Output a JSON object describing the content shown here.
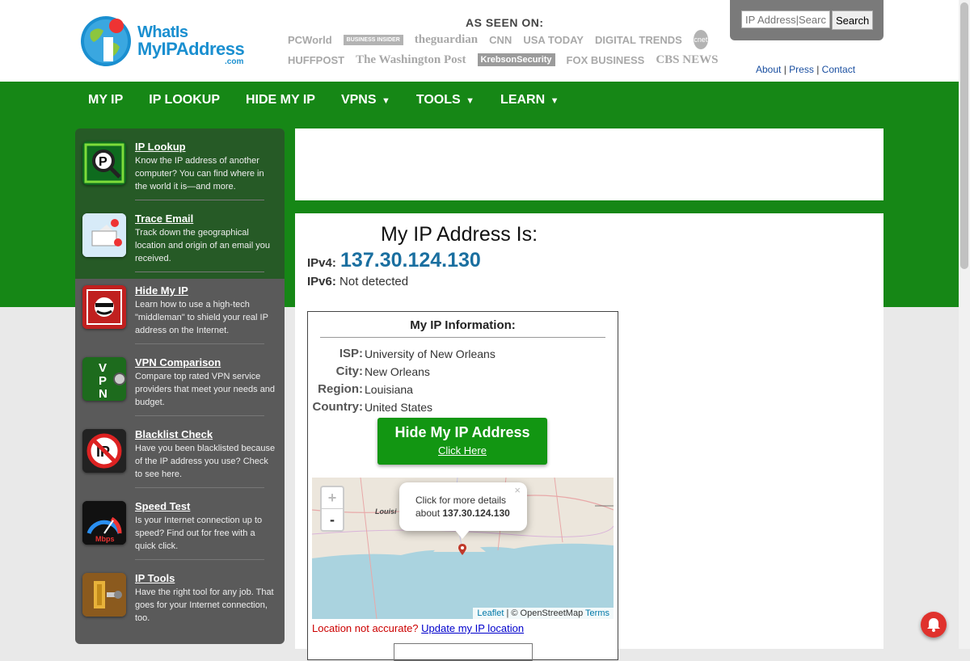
{
  "header": {
    "logo": {
      "line1": "WhatIs",
      "line2": "MyIPAddress",
      "line3": ".com"
    },
    "as_seen_on": "AS SEEN ON:",
    "media_row1": [
      "PCWorld",
      "BUSINESS INSIDER",
      "theguardian",
      "CNN",
      "USA TODAY",
      "DIGITAL TRENDS",
      "cnet"
    ],
    "media_row2": [
      "HUFFPOST",
      "The Washington Post",
      "KrebsonSecurity",
      "FOX BUSINESS",
      "CBS NEWS"
    ],
    "search": {
      "placeholder": "IP Address|Search",
      "button": "Search"
    },
    "links": {
      "about": "About",
      "press": "Press",
      "contact": "Contact",
      "sep": "|"
    }
  },
  "nav": [
    {
      "label": "MY IP",
      "caret": ""
    },
    {
      "label": "IP LOOKUP",
      "caret": ""
    },
    {
      "label": "HIDE MY IP",
      "caret": ""
    },
    {
      "label": "VPNS",
      "caret": "▼"
    },
    {
      "label": "TOOLS",
      "caret": "▼"
    },
    {
      "label": "LEARN",
      "caret": "▼"
    }
  ],
  "sidebar": [
    {
      "title": "IP Lookup",
      "desc": "Know the IP address of another computer? You can find where in the world it is—and more.",
      "icon": "ip-lookup-icon"
    },
    {
      "title": "Trace Email",
      "desc": "Track down the geographical location and origin of an email you received.",
      "icon": "trace-email-icon"
    },
    {
      "title": "Hide My IP",
      "desc": "Learn how to use a high-tech \"middleman\" to shield your real IP address on the Internet.",
      "icon": "hide-ip-icon"
    },
    {
      "title": "VPN Comparison",
      "desc": "Compare top rated VPN service providers that meet your needs and budget.",
      "icon": "vpn-icon"
    },
    {
      "title": "Blacklist Check",
      "desc": "Have you been blacklisted because of the IP address you use? Check to see here.",
      "icon": "blacklist-icon"
    },
    {
      "title": "Speed Test",
      "desc": "Is your Internet connection up to speed? Find out for free with a quick click.",
      "icon": "speed-test-icon"
    },
    {
      "title": "IP Tools",
      "desc": "Have the right tool for any job. That goes for your Internet connection, too.",
      "icon": "ip-tools-icon"
    }
  ],
  "main": {
    "heading": "My IP Address Is:",
    "ipv4_label": "IPv4:",
    "ipv4": "137.30.124.130",
    "ipv6_label": "IPv6:",
    "ipv6": "Not detected",
    "info_title": "My IP Information:",
    "info": [
      {
        "label": "ISP:",
        "value": "University of New Orleans"
      },
      {
        "label": "City:",
        "value": "New Orleans"
      },
      {
        "label": "Region:",
        "value": "Louisiana"
      },
      {
        "label": "Country:",
        "value": "United States"
      }
    ],
    "hide_btn": {
      "title": "Hide My IP Address",
      "link": "Click Here"
    },
    "map": {
      "zoom_in": "+",
      "zoom_out": "-",
      "popup_line1": "Click for more details",
      "popup_line2_prefix": "about",
      "popup_ip": "137.30.124.130",
      "popup_close": "×",
      "state_label": "Louisi",
      "attrib_leaflet": "Leaflet",
      "attrib_osm": "| © OpenStreetMap",
      "attrib_terms": "Terms"
    },
    "location_q": "Location not accurate?",
    "location_link": "Update my IP location"
  },
  "colors": {
    "green": "#168716",
    "button_green": "#129612",
    "ip_blue": "#1a6fa0",
    "sidebar_gray": "#5a5a5a"
  }
}
